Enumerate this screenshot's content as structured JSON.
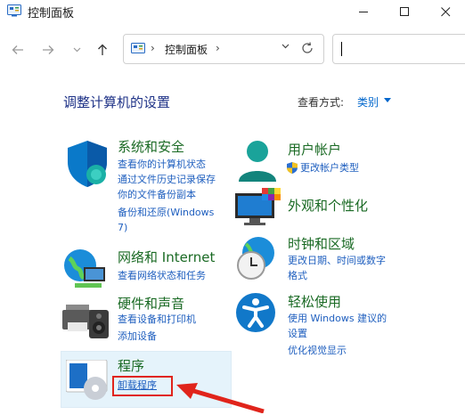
{
  "window": {
    "title": "控制面板",
    "icon": "control-panel-icon"
  },
  "nav": {
    "back_icon": "arrow-left-icon",
    "forward_icon": "arrow-right-icon",
    "recent_icon": "chevron-down-icon",
    "up_icon": "arrow-up-icon",
    "address": {
      "chevron": "›",
      "crumb": "控制面板",
      "chevron2": "›"
    },
    "search_placeholder": ""
  },
  "heading": {
    "title": "调整计算机的设置",
    "view_by_label": "查看方式:",
    "view_by_value": "类别"
  },
  "categories": {
    "system": {
      "title": "系统和安全",
      "links": [
        "查看你的计算机状态",
        "通过文件历史记录保存",
        "你的文件备份副本",
        "备份和还原(Windows",
        "7)"
      ]
    },
    "network": {
      "title": "网络和 Internet",
      "links": [
        "查看网络状态和任务"
      ]
    },
    "hardware": {
      "title": "硬件和声音",
      "links": [
        "查看设备和打印机",
        "添加设备"
      ]
    },
    "programs": {
      "title": "程序",
      "links": [
        "卸载程序"
      ]
    },
    "user": {
      "title": "用户帐户",
      "links": [
        "更改帐户类型"
      ]
    },
    "appearance": {
      "title": "外观和个性化",
      "links": []
    },
    "clock": {
      "title": "时钟和区域",
      "links": [
        "更改日期、时间或数字",
        "格式"
      ]
    },
    "ease": {
      "title": "轻松使用",
      "links": [
        "使用 Windows 建议的",
        "设置",
        "优化视觉显示"
      ]
    }
  },
  "colors": {
    "title_green": "#1a6a24",
    "link_blue": "#1f5fbf",
    "heading_blue": "#1e3287",
    "annotation_red": "#e0241b"
  }
}
